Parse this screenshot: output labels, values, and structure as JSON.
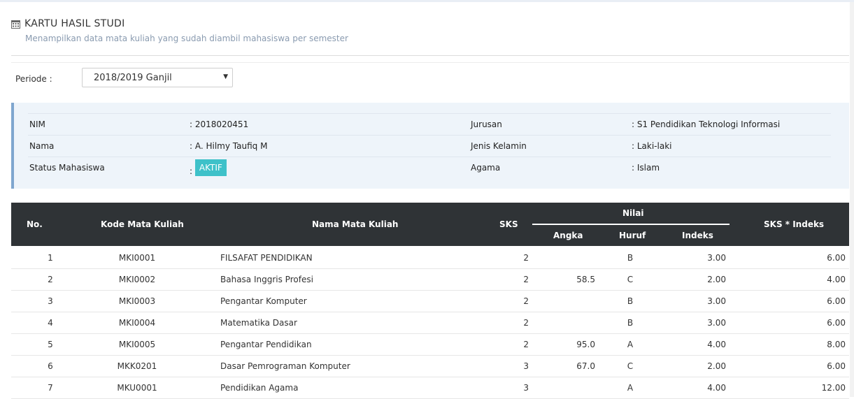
{
  "header": {
    "title": "KARTU HASIL STUDI",
    "subtitle": "Menampilkan data mata kuliah yang sudah diambil mahasiswa per semester",
    "icon": "calendar-icon"
  },
  "periode": {
    "label": "Periode :",
    "selected": "2018/2019 Ganjil",
    "arrow": "▼"
  },
  "student": {
    "nim_label": "NIM",
    "nim_value": ": 2018020451",
    "nama_label": "Nama",
    "nama_value": ": A. Hilmy Taufiq M",
    "status_label": "Status Mahasiswa",
    "status_prefix": ":",
    "status_value": "AKTIF",
    "jurusan_label": "Jurusan",
    "jurusan_value": ": S1 Pendidikan Teknologi Informasi",
    "jk_label": "Jenis Kelamin",
    "jk_value": ": Laki-laki",
    "agama_label": "Agama",
    "agama_value": ": Islam"
  },
  "table": {
    "headers": {
      "no": "No.",
      "kode": "Kode Mata Kuliah",
      "nama": "Nama Mata Kuliah",
      "sks": "SKS",
      "nilai": "Nilai",
      "angka": "Angka",
      "huruf": "Huruf",
      "indeks": "Indeks",
      "total": "SKS * Indeks"
    },
    "rows": [
      {
        "no": "1",
        "kode": "MKI0001",
        "nama": "FILSAFAT PENDIDIKAN",
        "sks": "2",
        "angka": "",
        "huruf": "B",
        "indeks": "3.00",
        "total": "6.00"
      },
      {
        "no": "2",
        "kode": "MKI0002",
        "nama": "Bahasa Inggris Profesi",
        "sks": "2",
        "angka": "58.5",
        "huruf": "C",
        "indeks": "2.00",
        "total": "4.00"
      },
      {
        "no": "3",
        "kode": "MKI0003",
        "nama": "Pengantar Komputer",
        "sks": "2",
        "angka": "",
        "huruf": "B",
        "indeks": "3.00",
        "total": "6.00"
      },
      {
        "no": "4",
        "kode": "MKI0004",
        "nama": "Matematika Dasar",
        "sks": "2",
        "angka": "",
        "huruf": "B",
        "indeks": "3.00",
        "total": "6.00"
      },
      {
        "no": "5",
        "kode": "MKI0005",
        "nama": "Pengantar Pendidikan",
        "sks": "2",
        "angka": "95.0",
        "huruf": "A",
        "indeks": "4.00",
        "total": "8.00"
      },
      {
        "no": "6",
        "kode": "MKK0201",
        "nama": "Dasar Pemrograman Komputer",
        "sks": "3",
        "angka": "67.0",
        "huruf": "C",
        "indeks": "2.00",
        "total": "6.00"
      },
      {
        "no": "7",
        "kode": "MKU0001",
        "nama": "Pendidikan Agama",
        "sks": "3",
        "angka": "",
        "huruf": "A",
        "indeks": "4.00",
        "total": "12.00"
      }
    ]
  },
  "colors": {
    "badge": "#3ec1c9",
    "table_header": "#2f3336",
    "panel_bg": "#eef4fa",
    "panel_accent": "#7fa6cf"
  }
}
